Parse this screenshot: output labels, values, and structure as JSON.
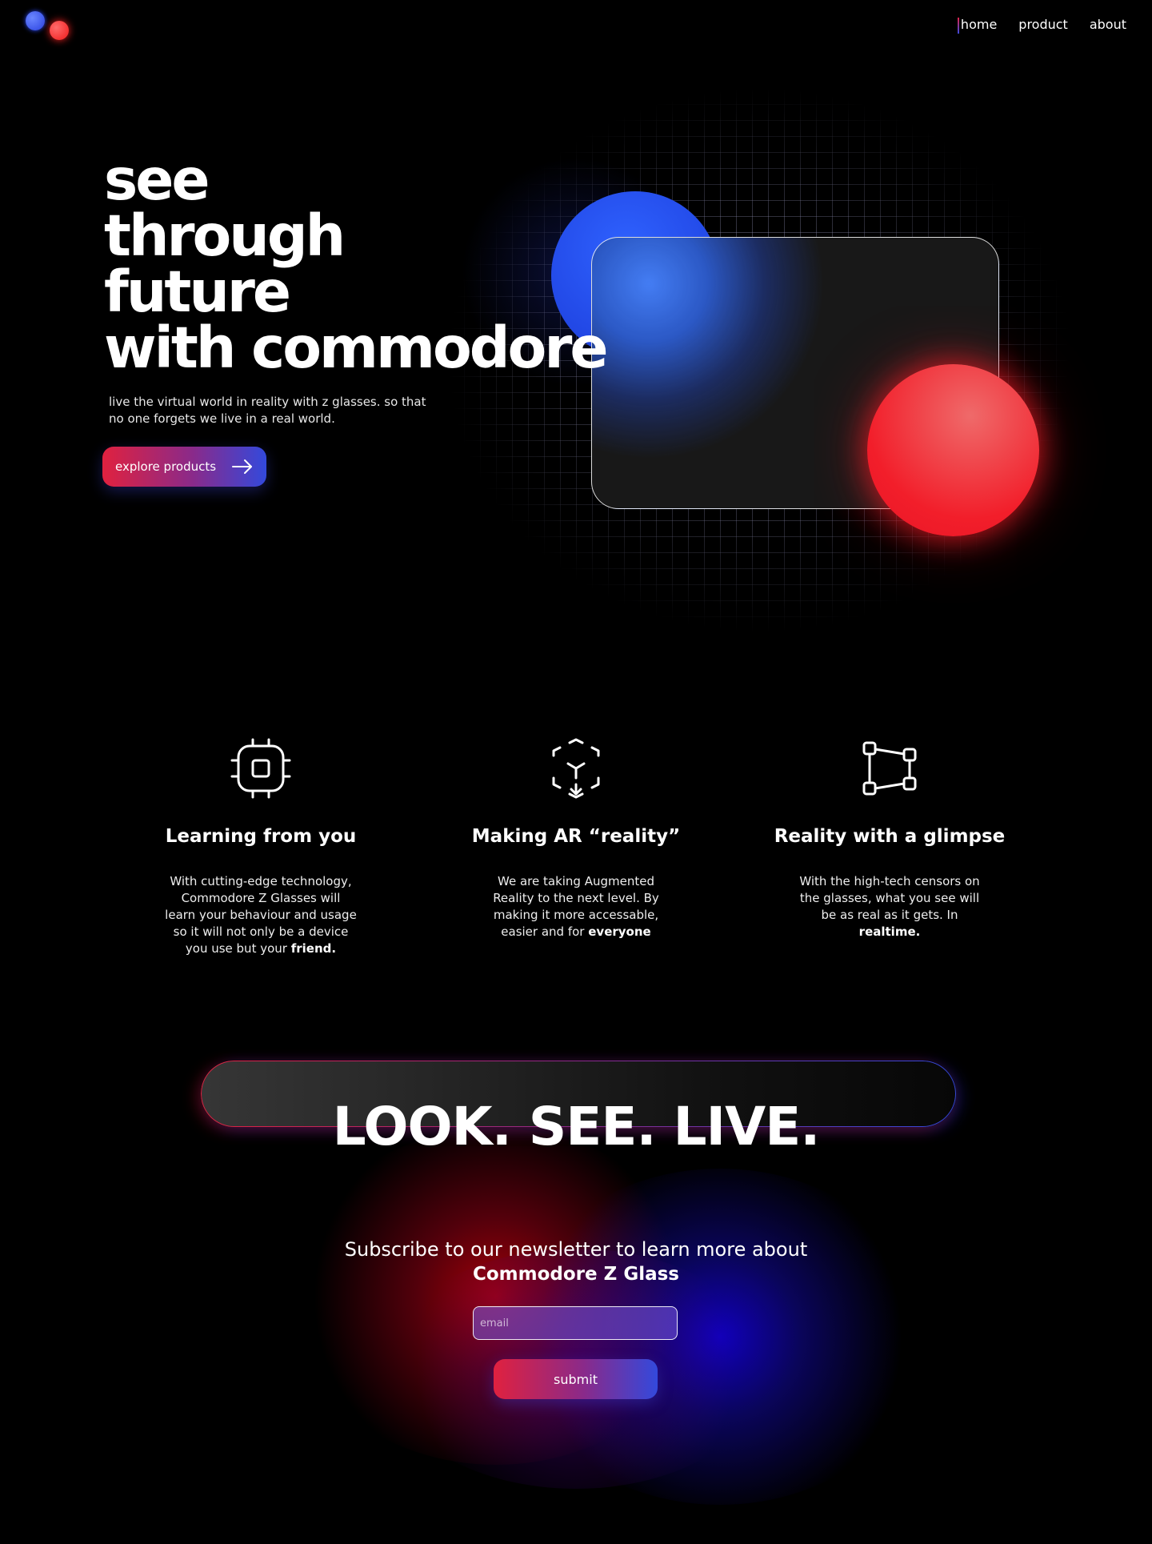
{
  "nav": {
    "items": [
      {
        "label": "home",
        "active": true
      },
      {
        "label": "product",
        "active": false
      },
      {
        "label": "about",
        "active": false
      }
    ]
  },
  "hero": {
    "title_lines": [
      "see",
      "through",
      "future",
      "with commodore"
    ],
    "subtitle": "live the virtual world in reality with z glasses. so that no one forgets we live in a real world.",
    "cta_label": "explore products"
  },
  "features": [
    {
      "icon": "chip-icon",
      "title": "Learning from you",
      "text": "With cutting-edge technology, Commodore Z Glasses will learn your behaviour and usage so it will not only be a device you use but your",
      "emphasis": "friend."
    },
    {
      "icon": "ar-cube-icon",
      "title": "Making AR “reality”",
      "text": "We are taking Augmented Reality to the next level. By making it more accessable, easier and for",
      "emphasis": "everyone"
    },
    {
      "icon": "nodes-icon",
      "title": "Reality with a glimpse",
      "text": "With the high-tech censors on the glasses, what you see will be as real as it gets. In",
      "emphasis": "realtime."
    }
  ],
  "banner": {
    "title": "LOOK. SEE. LIVE."
  },
  "newsletter": {
    "line1": "Subscribe to our newsletter to learn more about",
    "line2": "Commodore Z Glass",
    "email_placeholder": "email",
    "submit_label": "submit"
  },
  "colors": {
    "accent_red": "#e0213f",
    "accent_blue": "#3349dc",
    "background": "#000000"
  }
}
